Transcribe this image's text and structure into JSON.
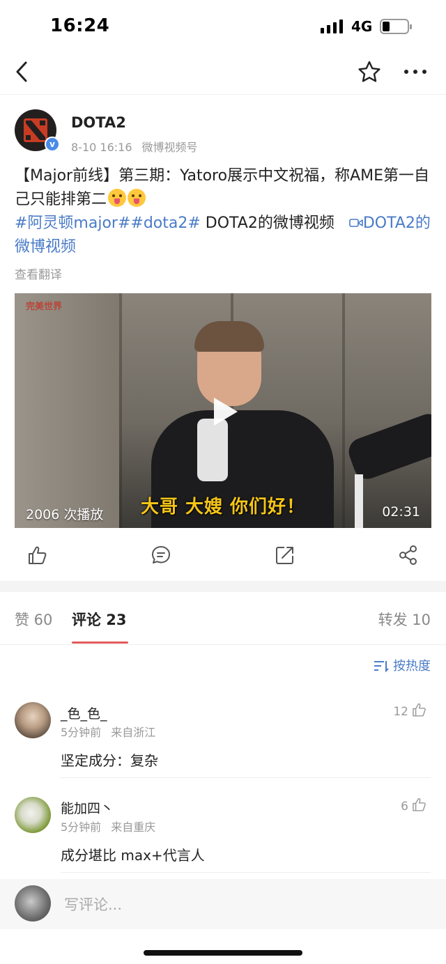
{
  "status_bar": {
    "time": "16:24",
    "network": "4G"
  },
  "post": {
    "author": "DOTA2",
    "date": "8-10 16:16",
    "source": "微博视频号",
    "body_line1": "【Major前线】第三期：Yatoro展示中文祝福，称AME第一自己只能排第二",
    "hashtags": "#阿灵顿major##dota2#",
    "video_caption": "DOTA2的微博视频",
    "video_link": "DOTA2的微博视频",
    "translate_label": "查看翻译"
  },
  "video": {
    "subtitle": "大哥 大嫂 你们好！",
    "play_count": "2006 次播放",
    "duration": "02:31",
    "watermark": "完美世界"
  },
  "tabs": [
    {
      "label": "赞 60"
    },
    {
      "label": "评论 23"
    },
    {
      "label": "转发 10"
    }
  ],
  "sort_label": "按热度",
  "comments": [
    {
      "name": "_色_色_",
      "time": "5分钟前",
      "location": "来自浙江",
      "likes": "12",
      "text": "坚定成分：复杂"
    },
    {
      "name": "能加四丶",
      "time": "5分钟前",
      "location": "来自重庆",
      "likes": "6",
      "text": "成分堪比 max+代言人"
    }
  ],
  "comment_input_placeholder": "写评论..."
}
